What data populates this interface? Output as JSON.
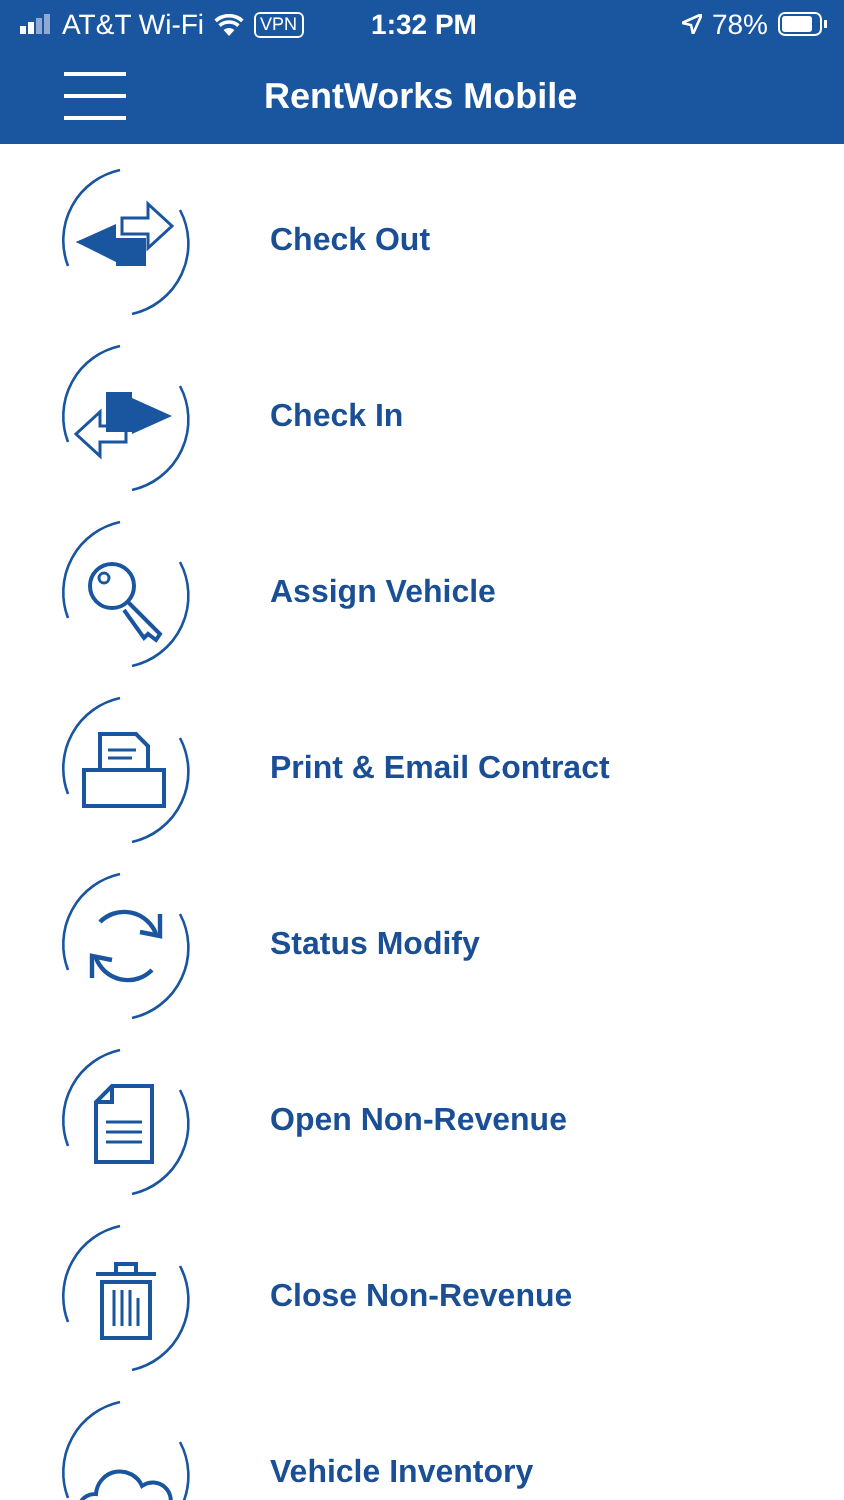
{
  "status_bar": {
    "carrier": "AT&T Wi-Fi",
    "vpn": "VPN",
    "time": "1:32 PM",
    "battery": "78%"
  },
  "header": {
    "title": "RentWorks Mobile"
  },
  "menu": [
    {
      "kind": "checkout",
      "label": "Check Out"
    },
    {
      "kind": "checkin",
      "label": "Check In"
    },
    {
      "kind": "key",
      "label": "Assign Vehicle"
    },
    {
      "kind": "printer",
      "label": "Print & Email Contract"
    },
    {
      "kind": "refresh",
      "label": "Status Modify"
    },
    {
      "kind": "document",
      "label": "Open Non-Revenue"
    },
    {
      "kind": "trash",
      "label": "Close Non-Revenue"
    },
    {
      "kind": "cloud",
      "label": "Vehicle Inventory"
    }
  ]
}
